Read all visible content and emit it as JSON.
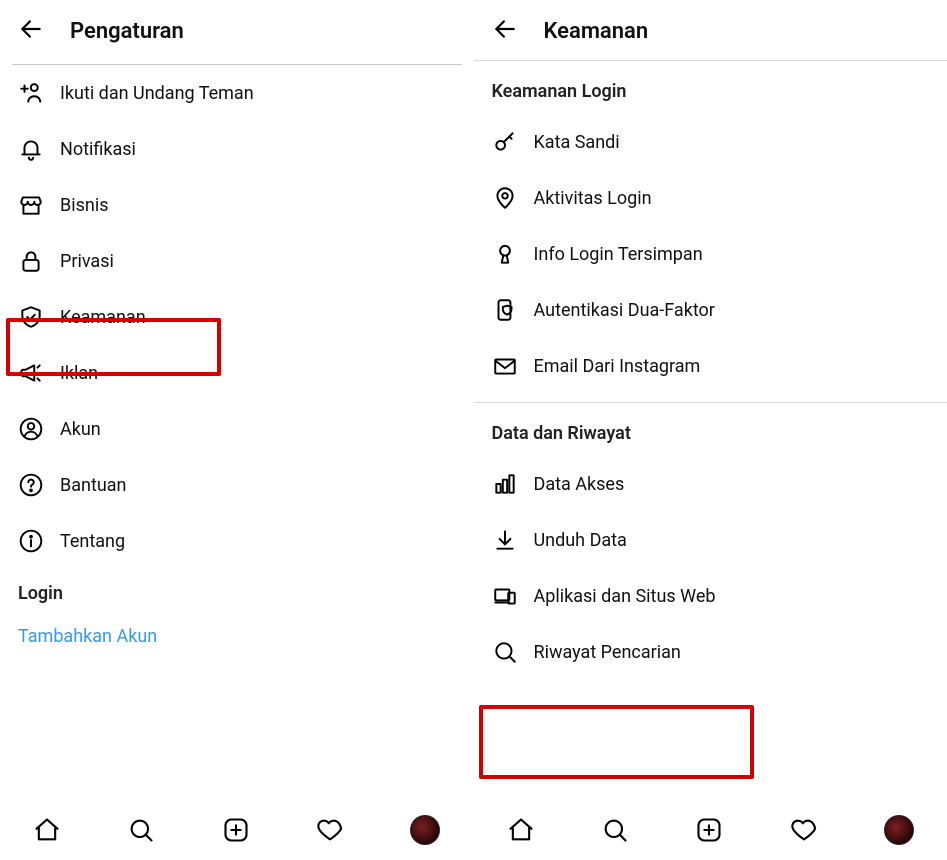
{
  "left": {
    "header": {
      "title": "Pengaturan"
    },
    "items": [
      {
        "label": "Ikuti dan Undang Teman"
      },
      {
        "label": "Notifikasi"
      },
      {
        "label": "Bisnis"
      },
      {
        "label": "Privasi"
      },
      {
        "label": "Keamanan"
      },
      {
        "label": "Iklan"
      },
      {
        "label": "Akun"
      },
      {
        "label": "Bantuan"
      },
      {
        "label": "Tentang"
      }
    ],
    "login_heading": "Login",
    "add_account": "Tambahkan Akun"
  },
  "right": {
    "header": {
      "title": "Keamanan"
    },
    "section1": {
      "title": "Keamanan Login",
      "items": [
        {
          "label": "Kata Sandi"
        },
        {
          "label": "Aktivitas Login"
        },
        {
          "label": "Info Login Tersimpan"
        },
        {
          "label": "Autentikasi Dua-Faktor"
        },
        {
          "label": "Email Dari Instagram"
        }
      ]
    },
    "section2": {
      "title": "Data dan Riwayat",
      "items": [
        {
          "label": "Data Akses"
        },
        {
          "label": "Unduh Data"
        },
        {
          "label": "Aplikasi dan Situs Web"
        },
        {
          "label": "Riwayat Pencarian"
        }
      ]
    }
  }
}
